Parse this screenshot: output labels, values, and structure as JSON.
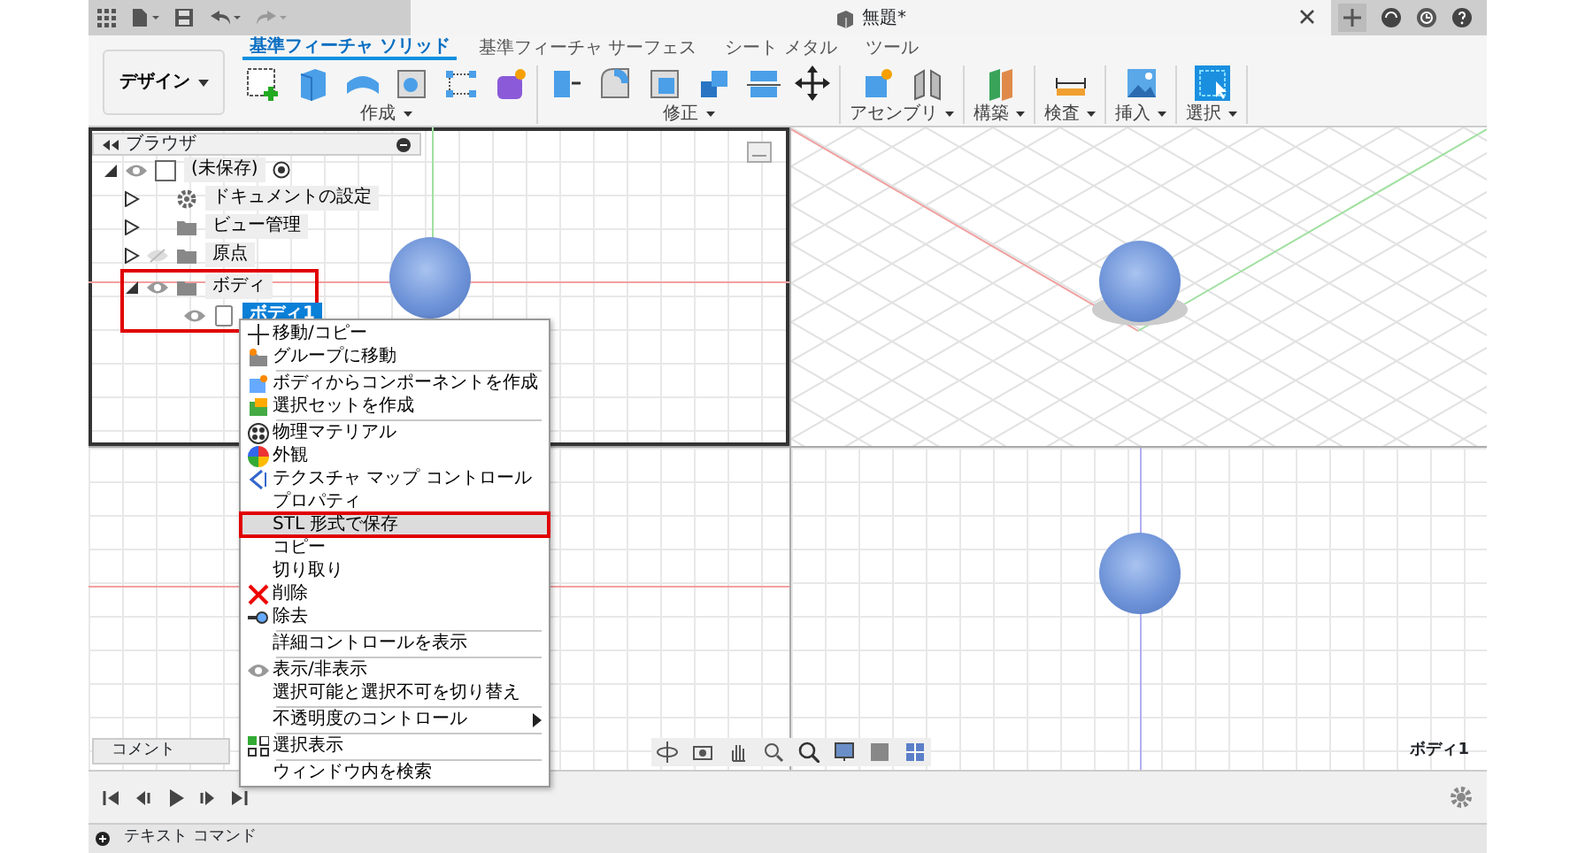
{
  "top_bar": {
    "document_title": "無題*"
  },
  "ribbon": {
    "workspace": "デザイン",
    "tabs": [
      {
        "label": "基準フィーチャ ソリッド",
        "selected": true
      },
      {
        "label": "基準フィーチャ サーフェス",
        "selected": false
      },
      {
        "label": "シート メタル",
        "selected": false
      },
      {
        "label": "ツール",
        "selected": false
      }
    ],
    "groups": [
      {
        "label": "作成"
      },
      {
        "label": "修正"
      },
      {
        "label": "アセンブリ"
      },
      {
        "label": "構築"
      },
      {
        "label": "検査"
      },
      {
        "label": "挿入"
      },
      {
        "label": "選択"
      }
    ]
  },
  "browser": {
    "title": "ブラウザ",
    "tree": [
      {
        "label": "(未保存)",
        "expanded": true,
        "visible": true,
        "selected": false,
        "highlighted": false,
        "children": [
          {
            "label": "ドキュメントの設定",
            "expanded": false,
            "selected": false,
            "highlighted": false
          },
          {
            "label": "ビュー管理",
            "expanded": false,
            "selected": false,
            "highlighted": false
          },
          {
            "label": "原点",
            "expanded": false,
            "visible": false,
            "selected": false,
            "highlighted": false
          },
          {
            "label": "ボディ",
            "expanded": true,
            "visible": true,
            "selected": false,
            "highlighted": true,
            "children": [
              {
                "label": "ボディ1",
                "visible": true,
                "selected": true,
                "highlighted": false
              }
            ]
          }
        ]
      }
    ]
  },
  "context_menu": {
    "groups": [
      {
        "items": [
          {
            "label": "移動/コピー",
            "highlighted": false
          },
          {
            "label": "グループに移動",
            "highlighted": false
          }
        ]
      },
      {
        "items": [
          {
            "label": "ボディからコンポーネントを作成",
            "highlighted": false
          },
          {
            "label": "選択セットを作成",
            "highlighted": false
          }
        ]
      },
      {
        "items": [
          {
            "label": "物理マテリアル",
            "highlighted": false
          },
          {
            "label": "外観",
            "highlighted": false
          },
          {
            "label": "テクスチャ マップ コントロール",
            "highlighted": false
          },
          {
            "label": "プロパティ",
            "highlighted": false
          },
          {
            "label": "STL 形式で保存",
            "highlighted": true
          },
          {
            "label": "コピー",
            "highlighted": false
          },
          {
            "label": "切り取り",
            "highlighted": false
          },
          {
            "label": "削除",
            "highlighted": false
          },
          {
            "label": "除去",
            "highlighted": false
          }
        ]
      },
      {
        "items": [
          {
            "label": "詳細コントロールを表示",
            "highlighted": false
          }
        ]
      },
      {
        "items": [
          {
            "label": "表示/非表示",
            "highlighted": false
          },
          {
            "label": "選択可能と選択不可を切り替え",
            "highlighted": false
          }
        ]
      },
      {
        "items": [
          {
            "label": "不透明度のコントロール",
            "highlighted": false,
            "kind": "submenu"
          }
        ]
      },
      {
        "items": [
          {
            "label": "選択表示",
            "highlighted": false
          }
        ]
      },
      {
        "items": [
          {
            "label": "ウィンドウ内を検索",
            "highlighted": false
          }
        ]
      }
    ]
  },
  "viewport": {
    "view_label": "ボディ1"
  },
  "comments": {
    "label": "コメント"
  },
  "text_command": {
    "label": "テキスト コマンド"
  }
}
